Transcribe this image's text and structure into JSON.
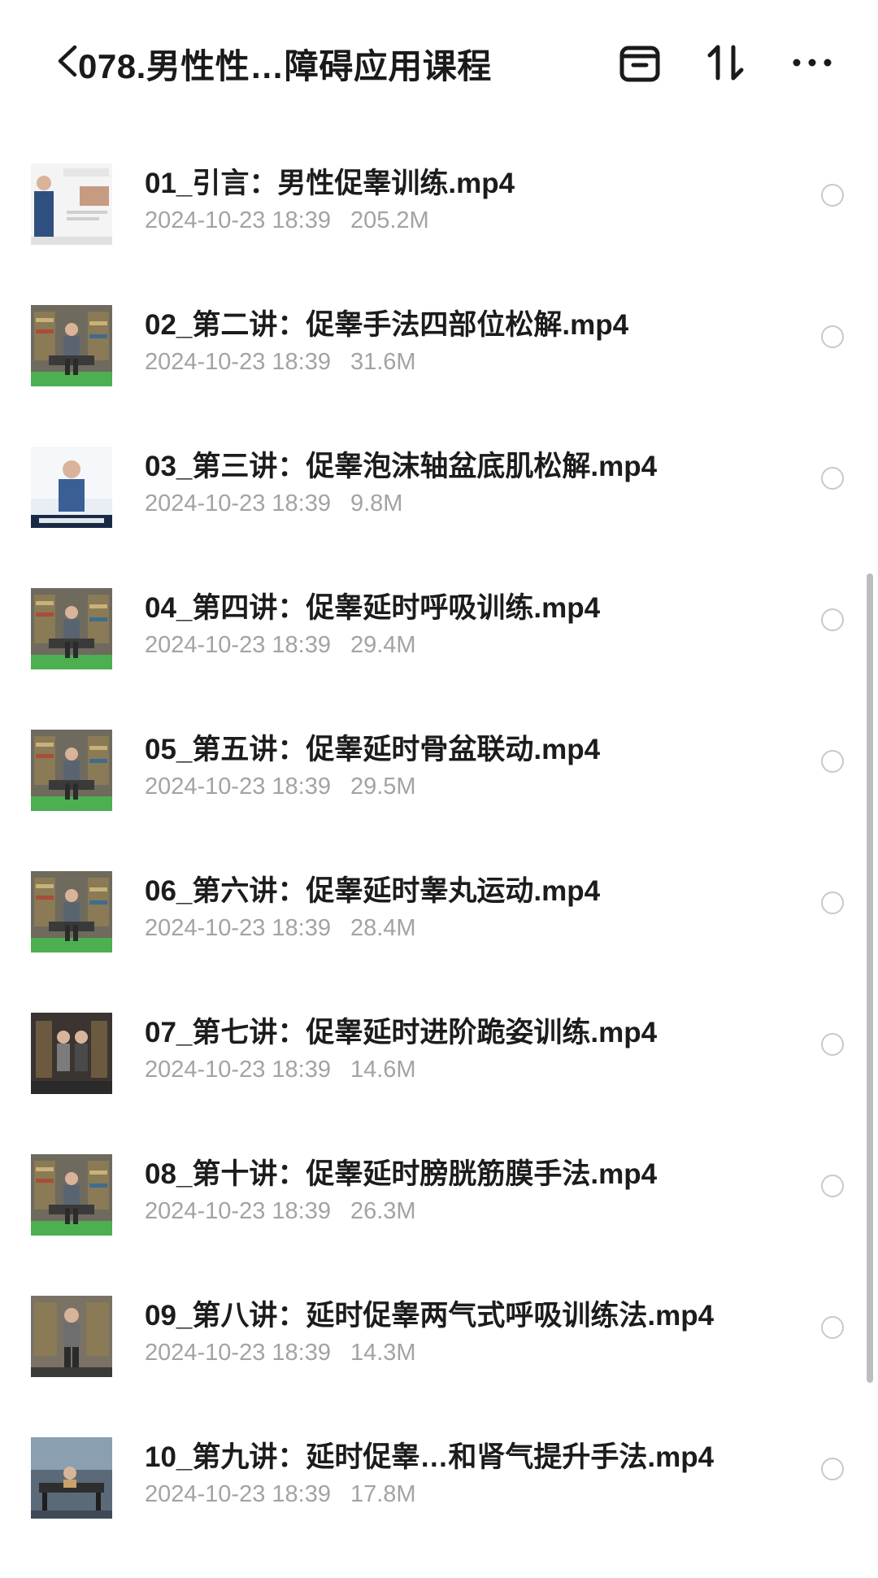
{
  "header": {
    "title": "078.男性性…障碍应用课程",
    "back_icon": "chevron-left-icon",
    "actions": [
      {
        "name": "archive-icon"
      },
      {
        "name": "sort-icon"
      },
      {
        "name": "more-icon"
      }
    ]
  },
  "files": [
    {
      "name": "01_引言：男性促睾训练.mp4",
      "date": "2024-10-23 18:39",
      "size": "205.2M"
    },
    {
      "name": "02_第二讲：促睾手法四部位松解.mp4",
      "date": "2024-10-23 18:39",
      "size": "31.6M"
    },
    {
      "name": "03_第三讲：促睾泡沫轴盆底肌松解.mp4",
      "date": "2024-10-23 18:39",
      "size": "9.8M"
    },
    {
      "name": "04_第四讲：促睾延时呼吸训练.mp4",
      "date": "2024-10-23 18:39",
      "size": "29.4M"
    },
    {
      "name": "05_第五讲：促睾延时骨盆联动.mp4",
      "date": "2024-10-23 18:39",
      "size": "29.5M"
    },
    {
      "name": "06_第六讲：促睾延时睾丸运动.mp4",
      "date": "2024-10-23 18:39",
      "size": "28.4M"
    },
    {
      "name": "07_第七讲：促睾延时进阶跪姿训练.mp4",
      "date": "2024-10-23 18:39",
      "size": "14.6M"
    },
    {
      "name": "08_第十讲：促睾延时膀胱筋膜手法.mp4",
      "date": "2024-10-23 18:39",
      "size": "26.3M"
    },
    {
      "name": "09_第八讲：延时促睾两气式呼吸训练法.mp4",
      "date": "2024-10-23 18:39",
      "size": "14.3M"
    },
    {
      "name": "10_第九讲：延时促睾…和肾气提升手法.mp4",
      "date": "2024-10-23 18:39",
      "size": "17.8M"
    }
  ],
  "colors": {
    "text_primary": "#1a1a1a",
    "text_secondary": "#a3a3a3",
    "radio_border": "#c9c9c9",
    "scrollbar": "#bdbdbd"
  }
}
